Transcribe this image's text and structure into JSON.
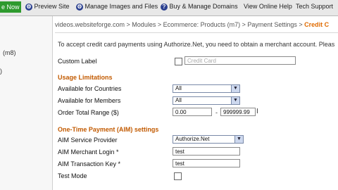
{
  "topbar": {
    "left_fragment": "e Now",
    "preview_site": "Preview Site",
    "manage_images": "Manage Images and Files",
    "buy_domains": "Buy & Manage Domains",
    "view_help": "View Online Help",
    "tech_support": "Tech Support"
  },
  "sidebar": {
    "item1": "(m8)",
    "item2": ")"
  },
  "breadcrumb": {
    "text": "videos.websiteforge.com > Modules > Ecommerce: Products (m7) > Payment Settings >",
    "current": "Credit C"
  },
  "intro_text": "To accept credit card payments using Authorize.Net, you need to obtain a merchant account. Pleas",
  "custom_label": {
    "label": "Custom Label",
    "placeholder": "Credit Card"
  },
  "usage_limitations": {
    "heading": "Usage Limitations",
    "countries_label": "Available for Countries",
    "countries_value": "All",
    "members_label": "Available for Members",
    "members_value": "All",
    "order_range_label": "Order Total Range ($)",
    "range_min": "0.00",
    "range_separator": "-",
    "range_max": "999999.99"
  },
  "aim": {
    "heading": "One-Time Payment (AIM) settings",
    "service_provider_label": "AIM Service Provider",
    "service_provider_value": "Authorize.Net",
    "merchant_login_label": "AIM Merchant Login *",
    "merchant_login_value": "test",
    "transaction_key_label": "AIM Transaction Key *",
    "transaction_key_value": "test",
    "test_mode_label": "Test Mode"
  }
}
